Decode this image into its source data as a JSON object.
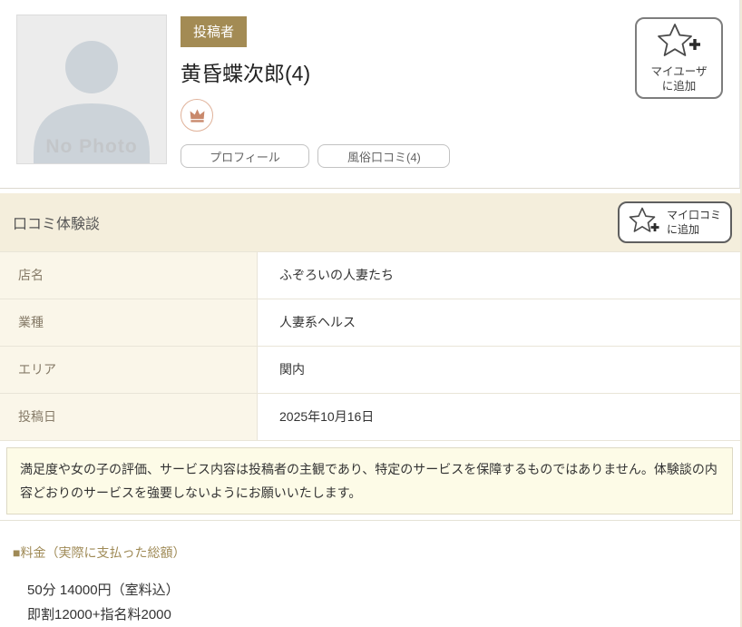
{
  "profile": {
    "no_photo_label": "No Photo",
    "badge": "投稿者",
    "username": "黄昏蝶次郎(4)",
    "buttons": {
      "profile": "プロフィール",
      "reviews": "風俗口コミ(4)"
    },
    "add_user_button": {
      "line1": "マイユーザ",
      "line2": "に追加"
    }
  },
  "review_section": {
    "title": "口コミ体験談",
    "add_review_button": {
      "line1": "マイ口コミ",
      "line2": "に追加"
    },
    "table": {
      "rows": [
        {
          "label": "店名",
          "value": "ふぞろいの人妻たち"
        },
        {
          "label": "業種",
          "value": "人妻系ヘルス"
        },
        {
          "label": "エリア",
          "value": "関内"
        },
        {
          "label": "投稿日",
          "value": "2025年10月16日"
        }
      ]
    },
    "notice": "満足度や女の子の評価、サービス内容は投稿者の主観であり、特定のサービスを保障するものではありません。体験談の内容どおりのサービスを強要しないようにお願いいたします。"
  },
  "price_section": {
    "heading": "■料金（実際に支払った総額）",
    "lines": [
      "50分 14000円（室料込）",
      "即割12000+指名料2000"
    ]
  },
  "icons": {
    "star_plus": "star-plus-icon",
    "crown": "crown-icon",
    "person": "person-silhouette-icon"
  },
  "colors": {
    "badge_gold": "#a38b54",
    "heading_brown": "#9f8a56",
    "band_beige": "#f4eedc",
    "label_cell_beige": "#faf6e9",
    "notice_bg": "#fdfbe7",
    "crown_copper": "#c9896c",
    "silhouette_gray": "#ccd3d9"
  }
}
